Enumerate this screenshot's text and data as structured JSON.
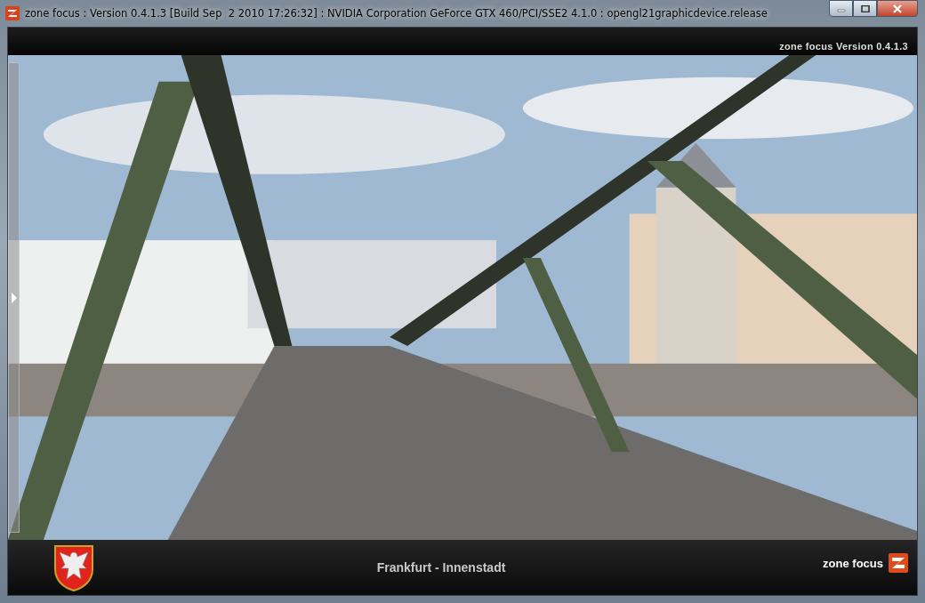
{
  "window": {
    "title": "zone focus : Version 0.4.1.3 [Build Sep  2 2010 17:26:32] : NVIDIA Corporation GeForce GTX 460/PCI/SSE2 4.1.0 : opengl21graphicdevice.release"
  },
  "top_bar": {
    "version": "zone focus Version 0.4.1.3"
  },
  "side_panel": {
    "expanded": false
  },
  "bottom_bar": {
    "location": "Frankfurt - Innenstadt",
    "brand": "zone focus"
  }
}
